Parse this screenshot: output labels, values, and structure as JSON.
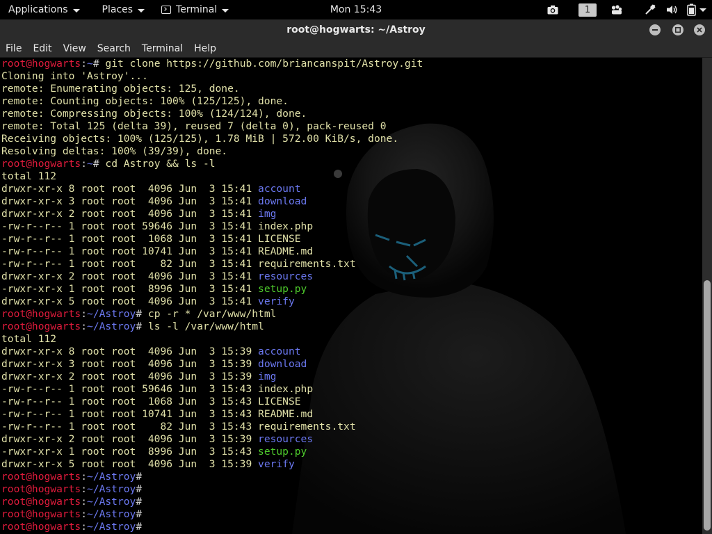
{
  "panel": {
    "applications_label": "Applications",
    "places_label": "Places",
    "terminal_label": "Terminal",
    "clock": "Mon 15:43",
    "workspace_number": "1",
    "icons": [
      "camera-icon",
      "workspace-indicator",
      "apps-grid-icon",
      "network-icon",
      "volume-icon",
      "battery-icon"
    ]
  },
  "window": {
    "title": "root@hogwarts: ~/Astroy",
    "buttons": [
      "minimize",
      "maximize",
      "close"
    ]
  },
  "menubar": {
    "items": [
      "File",
      "Edit",
      "View",
      "Search",
      "Terminal",
      "Help"
    ]
  },
  "prompt": {
    "user_host": "root@hogwarts",
    "colon": ":",
    "home_path": "~",
    "astroy_path": "~/Astroy",
    "hash": "#"
  },
  "terminal": {
    "lines": [
      {
        "type": "prompt",
        "path": "~",
        "cmd": " git clone https://github.com/briancanspit/Astroy.git"
      },
      {
        "type": "out",
        "text": "Cloning into 'Astroy'..."
      },
      {
        "type": "out",
        "text": "remote: Enumerating objects: 125, done."
      },
      {
        "type": "out",
        "text": "remote: Counting objects: 100% (125/125), done."
      },
      {
        "type": "out",
        "text": "remote: Compressing objects: 100% (124/124), done."
      },
      {
        "type": "out",
        "text": "remote: Total 125 (delta 39), reused 7 (delta 0), pack-reused 0"
      },
      {
        "type": "out",
        "text": "Receiving objects: 100% (125/125), 1.78 MiB | 572.00 KiB/s, done."
      },
      {
        "type": "out",
        "text": "Resolving deltas: 100% (39/39), done."
      },
      {
        "type": "prompt",
        "path": "~",
        "cmd": " cd Astroy && ls -l"
      },
      {
        "type": "out",
        "text": "total 112"
      },
      {
        "type": "ls",
        "prefix": "drwxr-xr-x 8 root root  4096 Jun  3 15:41 ",
        "name": "account",
        "kind": "dir"
      },
      {
        "type": "ls",
        "prefix": "drwxr-xr-x 3 root root  4096 Jun  3 15:41 ",
        "name": "download",
        "kind": "dir"
      },
      {
        "type": "ls",
        "prefix": "drwxr-xr-x 2 root root  4096 Jun  3 15:41 ",
        "name": "img",
        "kind": "dir"
      },
      {
        "type": "ls",
        "prefix": "-rw-r--r-- 1 root root 59646 Jun  3 15:41 ",
        "name": "index.php",
        "kind": "file"
      },
      {
        "type": "ls",
        "prefix": "-rw-r--r-- 1 root root  1068 Jun  3 15:41 ",
        "name": "LICENSE",
        "kind": "file"
      },
      {
        "type": "ls",
        "prefix": "-rw-r--r-- 1 root root 10741 Jun  3 15:41 ",
        "name": "README.md",
        "kind": "file"
      },
      {
        "type": "ls",
        "prefix": "-rw-r--r-- 1 root root    82 Jun  3 15:41 ",
        "name": "requirements.txt",
        "kind": "file"
      },
      {
        "type": "ls",
        "prefix": "drwxr-xr-x 2 root root  4096 Jun  3 15:41 ",
        "name": "resources",
        "kind": "dir"
      },
      {
        "type": "ls",
        "prefix": "-rwxr-xr-x 1 root root  8996 Jun  3 15:41 ",
        "name": "setup.py",
        "kind": "exec"
      },
      {
        "type": "ls",
        "prefix": "drwxr-xr-x 5 root root  4096 Jun  3 15:41 ",
        "name": "verify",
        "kind": "dir"
      },
      {
        "type": "prompt",
        "path": "~/Astroy",
        "cmd": " cp -r * /var/www/html"
      },
      {
        "type": "prompt",
        "path": "~/Astroy",
        "cmd": " ls -l /var/www/html"
      },
      {
        "type": "out",
        "text": "total 112"
      },
      {
        "type": "ls",
        "prefix": "drwxr-xr-x 8 root root  4096 Jun  3 15:39 ",
        "name": "account",
        "kind": "dir"
      },
      {
        "type": "ls",
        "prefix": "drwxr-xr-x 3 root root  4096 Jun  3 15:39 ",
        "name": "download",
        "kind": "dir"
      },
      {
        "type": "ls",
        "prefix": "drwxr-xr-x 2 root root  4096 Jun  3 15:39 ",
        "name": "img",
        "kind": "dir"
      },
      {
        "type": "ls",
        "prefix": "-rw-r--r-- 1 root root 59646 Jun  3 15:43 ",
        "name": "index.php",
        "kind": "file"
      },
      {
        "type": "ls",
        "prefix": "-rw-r--r-- 1 root root  1068 Jun  3 15:43 ",
        "name": "LICENSE",
        "kind": "file"
      },
      {
        "type": "ls",
        "prefix": "-rw-r--r-- 1 root root 10741 Jun  3 15:43 ",
        "name": "README.md",
        "kind": "file"
      },
      {
        "type": "ls",
        "prefix": "-rw-r--r-- 1 root root    82 Jun  3 15:43 ",
        "name": "requirements.txt",
        "kind": "file"
      },
      {
        "type": "ls",
        "prefix": "drwxr-xr-x 2 root root  4096 Jun  3 15:39 ",
        "name": "resources",
        "kind": "dir"
      },
      {
        "type": "ls",
        "prefix": "-rwxr-xr-x 1 root root  8996 Jun  3 15:43 ",
        "name": "setup.py",
        "kind": "exec"
      },
      {
        "type": "ls",
        "prefix": "drwxr-xr-x 5 root root  4096 Jun  3 15:39 ",
        "name": "verify",
        "kind": "dir"
      },
      {
        "type": "prompt",
        "path": "~/Astroy",
        "cmd": ""
      },
      {
        "type": "prompt",
        "path": "~/Astroy",
        "cmd": ""
      },
      {
        "type": "prompt",
        "path": "~/Astroy",
        "cmd": ""
      },
      {
        "type": "prompt",
        "path": "~/Astroy",
        "cmd": ""
      },
      {
        "type": "prompt",
        "path": "~/Astroy",
        "cmd": ""
      }
    ]
  },
  "colors": {
    "prompt_user": "#e01b3c",
    "prompt_path": "#6b78f0",
    "directory": "#6b78f0",
    "executable": "#4ecb2c",
    "output_text": "#e0e0a8",
    "panel_bg": "#000000",
    "titlebar_bg": "#2b2b2b"
  }
}
